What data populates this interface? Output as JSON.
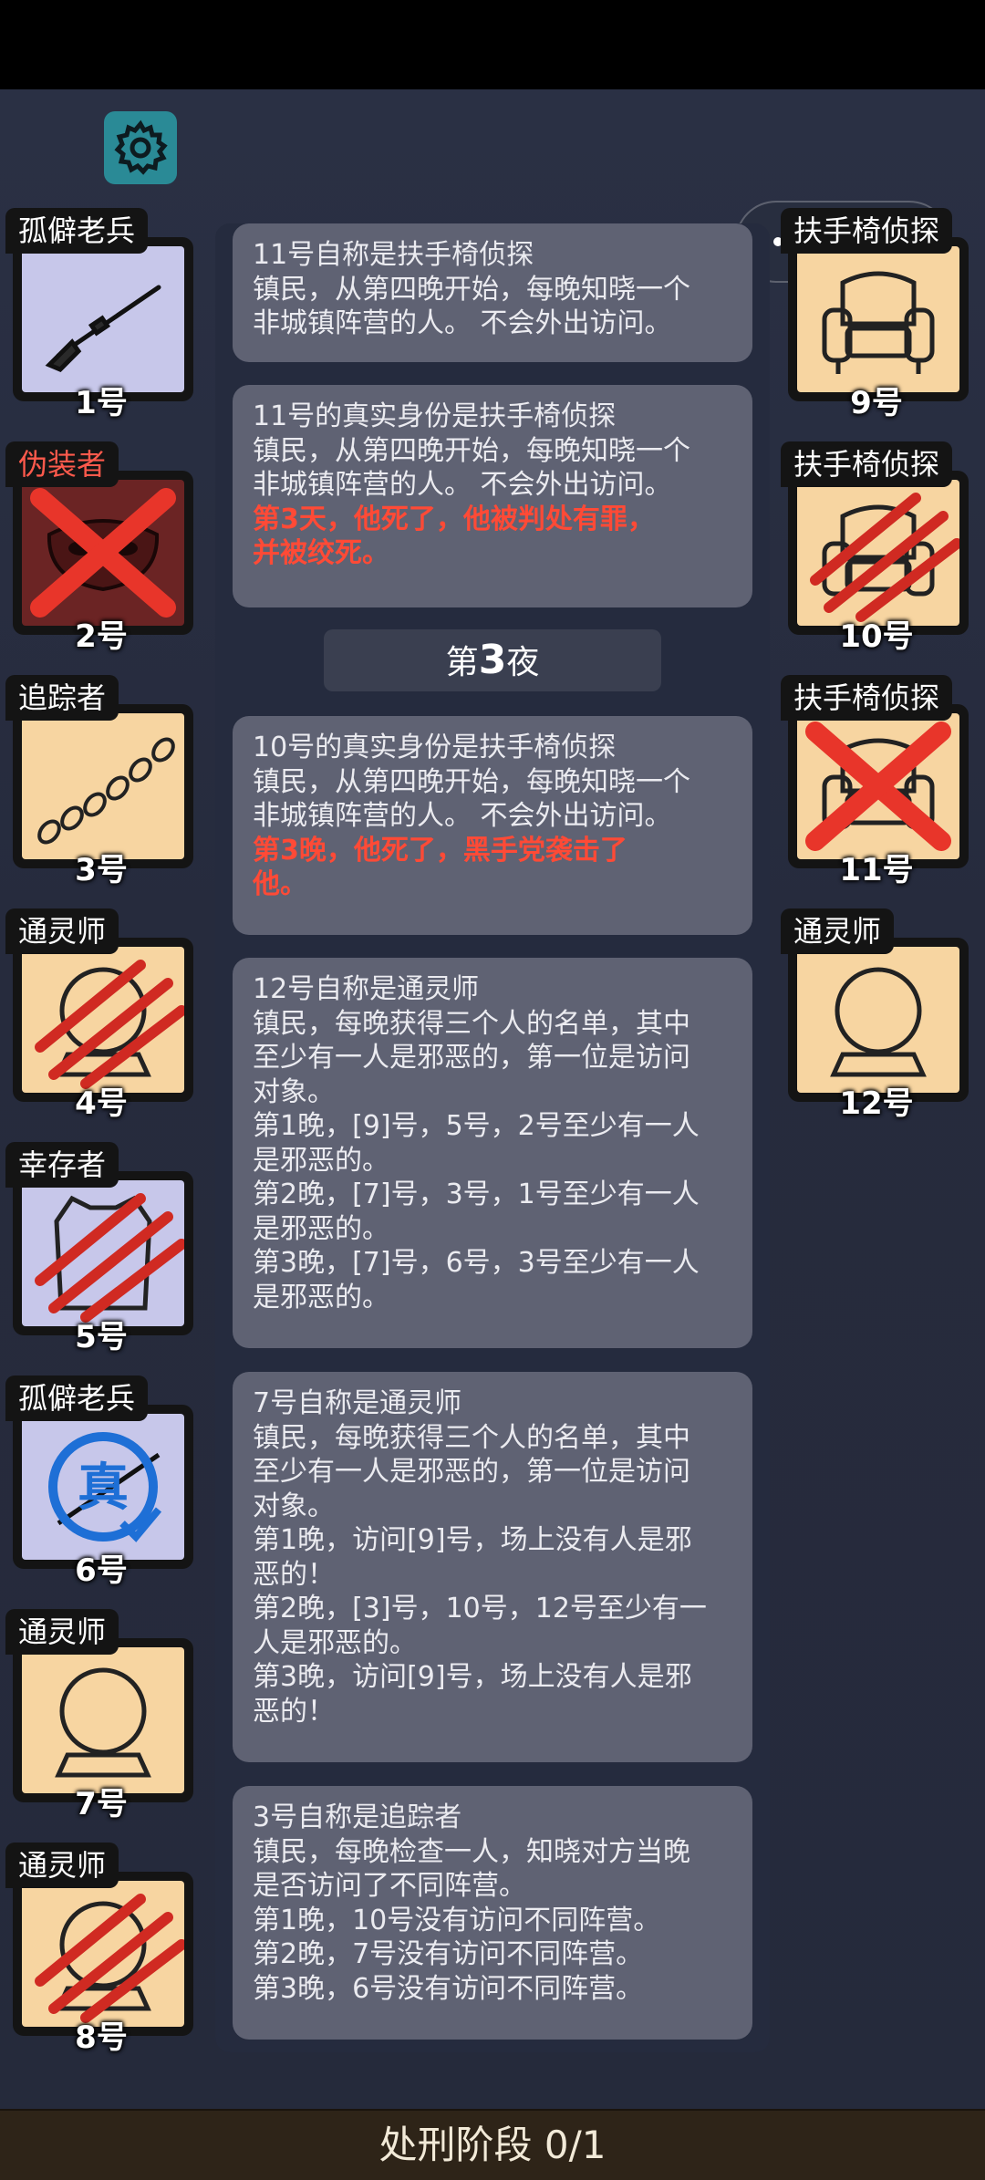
{
  "top": {
    "settings_icon": "gear-icon",
    "capsule_menu_icon": "more-dots-icon",
    "capsule_close_icon": "target-icon"
  },
  "players_left": [
    {
      "role": "孤僻老兵",
      "num": "1号",
      "art": "rifle",
      "bg": "lavender",
      "status": "alive"
    },
    {
      "role": "伪装者",
      "num": "2号",
      "art": "mask",
      "bg": "dark-red",
      "status": "executed",
      "role_color": "#ff5a4c"
    },
    {
      "role": "追踪者",
      "num": "3号",
      "art": "footprints",
      "bg": "tan",
      "status": "alive"
    },
    {
      "role": "通灵师",
      "num": "4号",
      "art": "crystal-ball",
      "bg": "tan",
      "status": "killed"
    },
    {
      "role": "幸存者",
      "num": "5号",
      "art": "vest",
      "bg": "lavender",
      "status": "killed"
    },
    {
      "role": "孤僻老兵",
      "num": "6号",
      "art": "rifle",
      "bg": "lavender",
      "status": "verified",
      "badge": "真"
    },
    {
      "role": "通灵师",
      "num": "7号",
      "art": "crystal-ball",
      "bg": "tan",
      "status": "alive"
    },
    {
      "role": "通灵师",
      "num": "8号",
      "art": "crystal-ball",
      "bg": "tan",
      "status": "killed"
    }
  ],
  "players_right": [
    {
      "role": "扶手椅侦探",
      "num": "9号",
      "art": "armchair",
      "bg": "tan",
      "status": "alive"
    },
    {
      "role": "扶手椅侦探",
      "num": "10号",
      "art": "armchair",
      "bg": "tan",
      "status": "killed"
    },
    {
      "role": "扶手椅侦探",
      "num": "11号",
      "art": "armchair",
      "bg": "tan",
      "status": "executed"
    },
    {
      "role": "通灵师",
      "num": "12号",
      "art": "crystal-ball",
      "bg": "tan",
      "status": "alive"
    }
  ],
  "log": {
    "msg1": [
      "11号自称是扶手椅侦探",
      "镇民，从第四晚开始，每晚知晓一个",
      "非城镇阵营的人。 不会外出访问。"
    ],
    "msg2": [
      "11号的真实身份是扶手椅侦探",
      "镇民，从第四晚开始，每晚知晓一个",
      "非城镇阵营的人。 不会外出访问。"
    ],
    "msg2_death": [
      "第3天，他死了，他被判处有罪，",
      "并被绞死。"
    ],
    "night_prefix": "第",
    "night_number": "3",
    "night_suffix": "夜",
    "msg3": [
      "10号的真实身份是扶手椅侦探",
      "镇民，从第四晚开始，每晚知晓一个",
      "非城镇阵营的人。 不会外出访问。"
    ],
    "msg3_death": [
      "第3晚，他死了，黑手党袭击了",
      "他。"
    ],
    "msg4": [
      "12号自称是通灵师",
      "镇民，每晚获得三个人的名单，其中",
      "至少有一人是邪恶的，第一位是访问",
      "对象。",
      "第1晚，[9]号，5号，2号至少有一人",
      "是邪恶的。",
      "第2晚，[7]号，3号，1号至少有一人",
      "是邪恶的。",
      "第3晚，[7]号，6号，3号至少有一人",
      "是邪恶的。"
    ],
    "msg5": [
      "7号自称是通灵师",
      "镇民，每晚获得三个人的名单，其中",
      "至少有一人是邪恶的，第一位是访问",
      "对象。",
      "第1晚，访问[9]号，场上没有人是邪",
      "恶的！",
      "第2晚，[3]号，10号，12号至少有一",
      "人是邪恶的。",
      "第3晚，访问[9]号，场上没有人是邪",
      "恶的！"
    ],
    "msg6": [
      "3号自称是追踪者",
      "镇民，每晚检查一人，知晓对方当晚",
      "是否访问了不同阵营。",
      "第1晚，10号没有访问不同阵营。",
      "第2晚，7号没有访问不同阵营。",
      "第3晚，6号没有访问不同阵营。"
    ]
  },
  "footer": {
    "phase": "处刑阶段 0/1"
  },
  "colors": {
    "lavender": "#c7c7ea",
    "tan": "#f7d5a1",
    "dark_red": "#6b2424",
    "death_text": "#ff4a36",
    "accent": "#2a8a96"
  }
}
